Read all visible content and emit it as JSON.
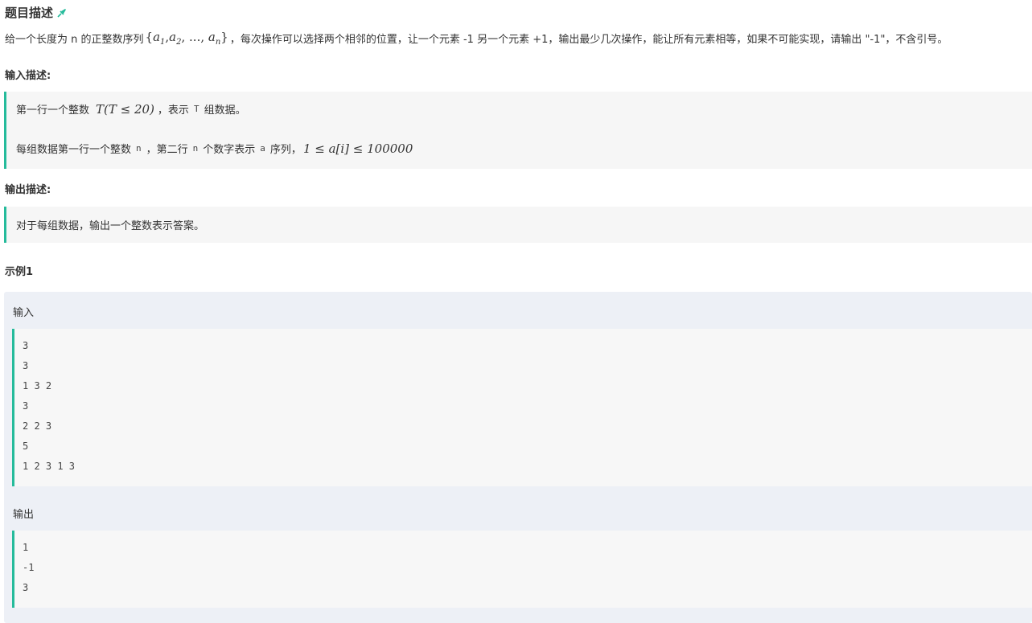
{
  "title": "题目描述",
  "pin_icon": "pin-icon",
  "description": {
    "before": "给一个长度为 n 的正整数序列",
    "math_seq_open": "{",
    "a": "a",
    "sub1": "1",
    "sub2": "2",
    "ellipsis": ", ..., ",
    "subn": "n",
    "math_seq_close": "}",
    "after": "，每次操作可以选择两个相邻的位置，让一个元素 -1 另一个元素 +1，输出最少几次操作，能让所有元素相等，如果不可能实现，请输出 \"-1\"，不含引号。"
  },
  "input_section": {
    "label": "输入描述:",
    "line1": {
      "prefix": "第一行一个整数",
      "math": "T(T ≤ 20)",
      "middle": "，表示",
      "code": "T",
      "suffix": "组数据。"
    },
    "line2": {
      "prefix": "每组数据第一行一个整数",
      "code_n": "n",
      "middle1": "，第二行",
      "code_n2": "n",
      "middle2": "个数字表示",
      "code_a": "a",
      "middle3": "序列，",
      "math": "1 ≤ a[i] ≤ 100000"
    }
  },
  "output_section": {
    "label": "输出描述:",
    "line1": "对于每组数据，输出一个整数表示答案。"
  },
  "example": {
    "heading": "示例1",
    "input_label": "输入",
    "input_lines": [
      "3",
      "3",
      "1 3 2",
      "3",
      "2 2 3",
      "5",
      "1 2 3 1 3"
    ],
    "output_label": "输出",
    "output_lines": [
      "1",
      "-1",
      "3"
    ]
  },
  "colors": {
    "accent": "#25bb9b",
    "example_bg": "#edf0f6",
    "block_bg": "#f6f6f6"
  }
}
